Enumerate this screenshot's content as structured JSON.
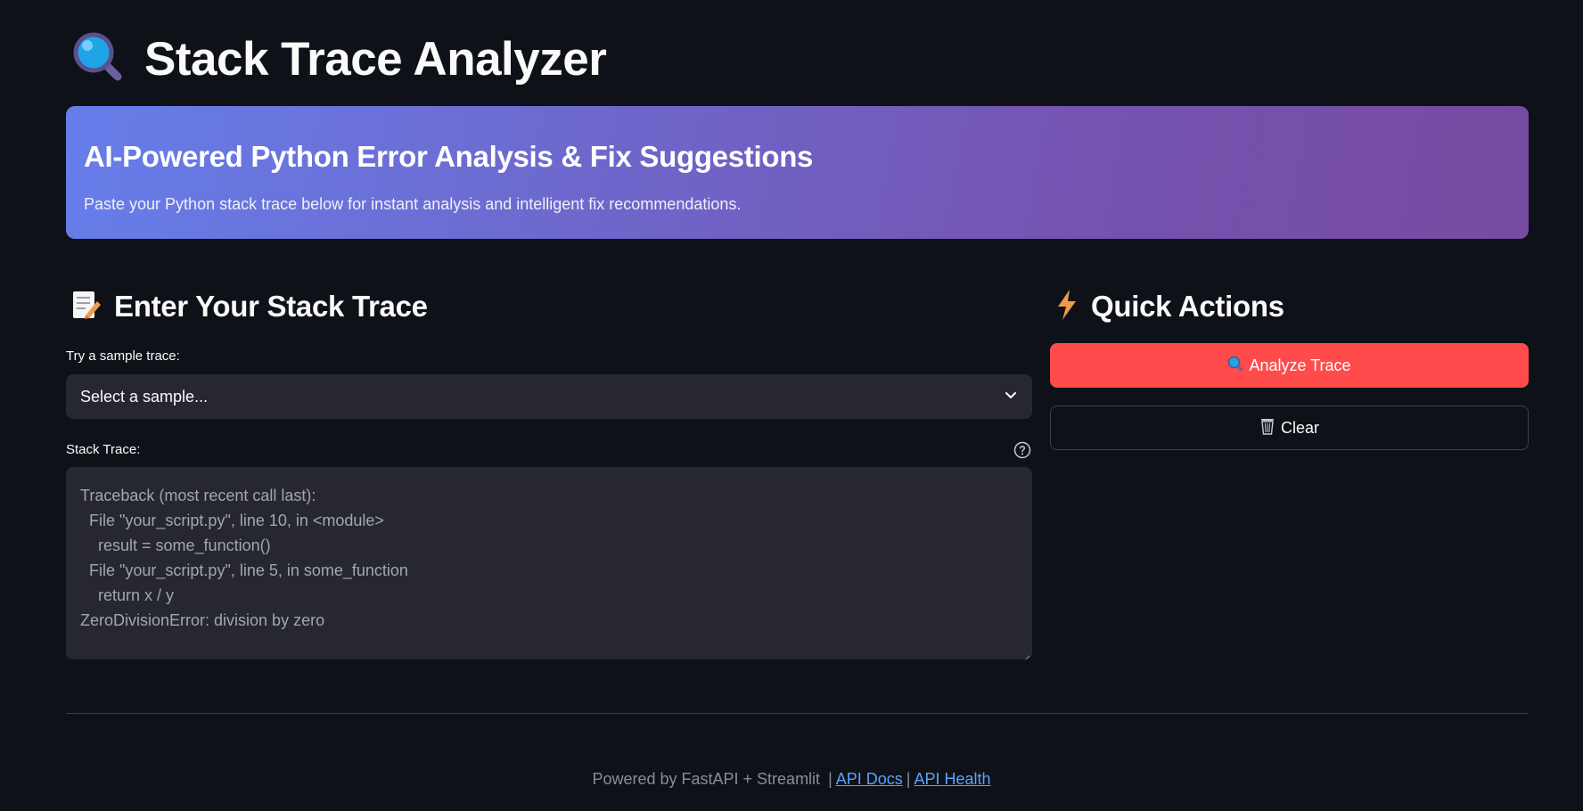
{
  "header": {
    "title": "Stack Trace Analyzer",
    "icon": "magnifying-glass-icon"
  },
  "hero": {
    "heading": "AI-Powered Python Error Analysis & Fix Suggestions",
    "subtitle": "Paste your Python stack trace below for instant analysis and intelligent fix recommendations.",
    "gradient_start": "#667eea",
    "gradient_end": "#764ba2"
  },
  "input_section": {
    "heading": "Enter Your Stack Trace",
    "icon": "memo-icon",
    "sample_label": "Try a sample trace:",
    "sample_select_value": "Select a sample...",
    "trace_label": "Stack Trace:",
    "trace_placeholder_lines": [
      "Traceback (most recent call last):",
      "  File \"your_script.py\", line 10, in <module>",
      "    result = some_function()",
      "  File \"your_script.py\", line 5, in some_function",
      "    return x / y",
      "ZeroDivisionError: division by zero"
    ]
  },
  "actions": {
    "heading": "Quick Actions",
    "icon": "lightning-icon",
    "analyze_label": "Analyze Trace",
    "analyze_icon": "magnifying-glass-icon",
    "clear_label": "Clear",
    "clear_icon": "wastebasket-icon",
    "primary_color": "#ff4b4b"
  },
  "footer": {
    "prefix": "Powered by FastAPI + Streamlit",
    "separator": "|",
    "api_docs_label": "API Docs",
    "api_health_label": "API Health"
  }
}
